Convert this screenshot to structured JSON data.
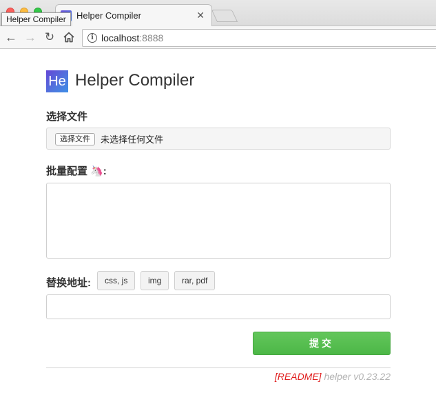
{
  "browser": {
    "tab_title": "Helper Compiler",
    "tab_favicon_text": "He",
    "tooltip": "Helper Compiler",
    "url_host": "localhost",
    "url_port": ":8888",
    "tab_close_icon": "close-icon",
    "traffic_colors": {
      "close": "#fc605c",
      "minimize": "#fdbc40",
      "maximize": "#34c84a"
    }
  },
  "app": {
    "logo_text": "He",
    "title": "Helper Compiler",
    "brand_gradient": [
      "#6447d6",
      "#3f8ee6"
    ]
  },
  "form": {
    "file_label": "选择文件",
    "file_button": "选择文件",
    "file_status": "未选择任何文件",
    "batch_label": "批量配置",
    "batch_suffix": ":",
    "batch_icon": "unicorn-icon",
    "batch_value": "",
    "replace_label": "替换地址:",
    "chips": [
      "css, js",
      "img",
      "rar, pdf"
    ],
    "replace_value": "",
    "submit_label": "提交",
    "submit_color": "#4cb747"
  },
  "footer": {
    "readme": "[README]",
    "version": "helper v0.23.22",
    "readme_color": "#e02020"
  }
}
